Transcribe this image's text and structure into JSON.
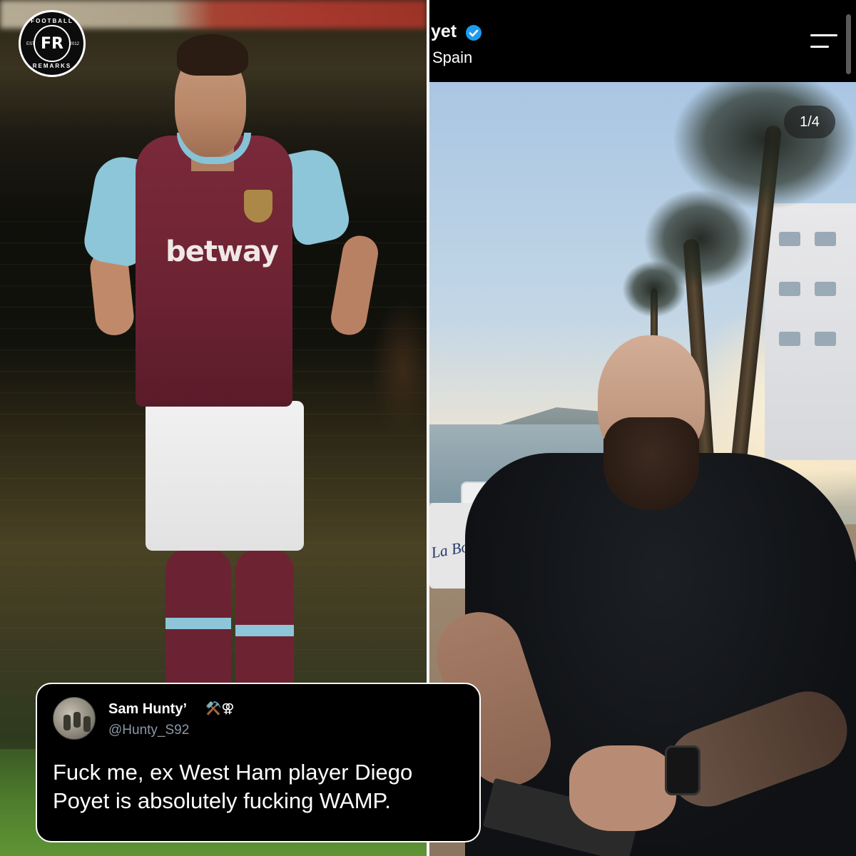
{
  "logo": {
    "top_text": "FOOTBALL",
    "monogram": "FR",
    "bottom_text": "REMARKS",
    "est": "EST",
    "year": "2012"
  },
  "left_photo": {
    "sponsor": "betway"
  },
  "instagram": {
    "username": "yet",
    "location": "Spain",
    "verified_icon": "verified-badge-icon",
    "menu_icon": "hamburger-menu-icon",
    "photo_counter": "1/4",
    "sign_text": "La Bocan",
    "accent": "#1d9bf0"
  },
  "tweet": {
    "display_name": "Sam Hunty’",
    "name_icons": "⚒️⚢",
    "handle": "@Hunty_S92",
    "text": "Fuck me, ex West Ham player Diego Poyet is absolutely fucking WAMP."
  }
}
